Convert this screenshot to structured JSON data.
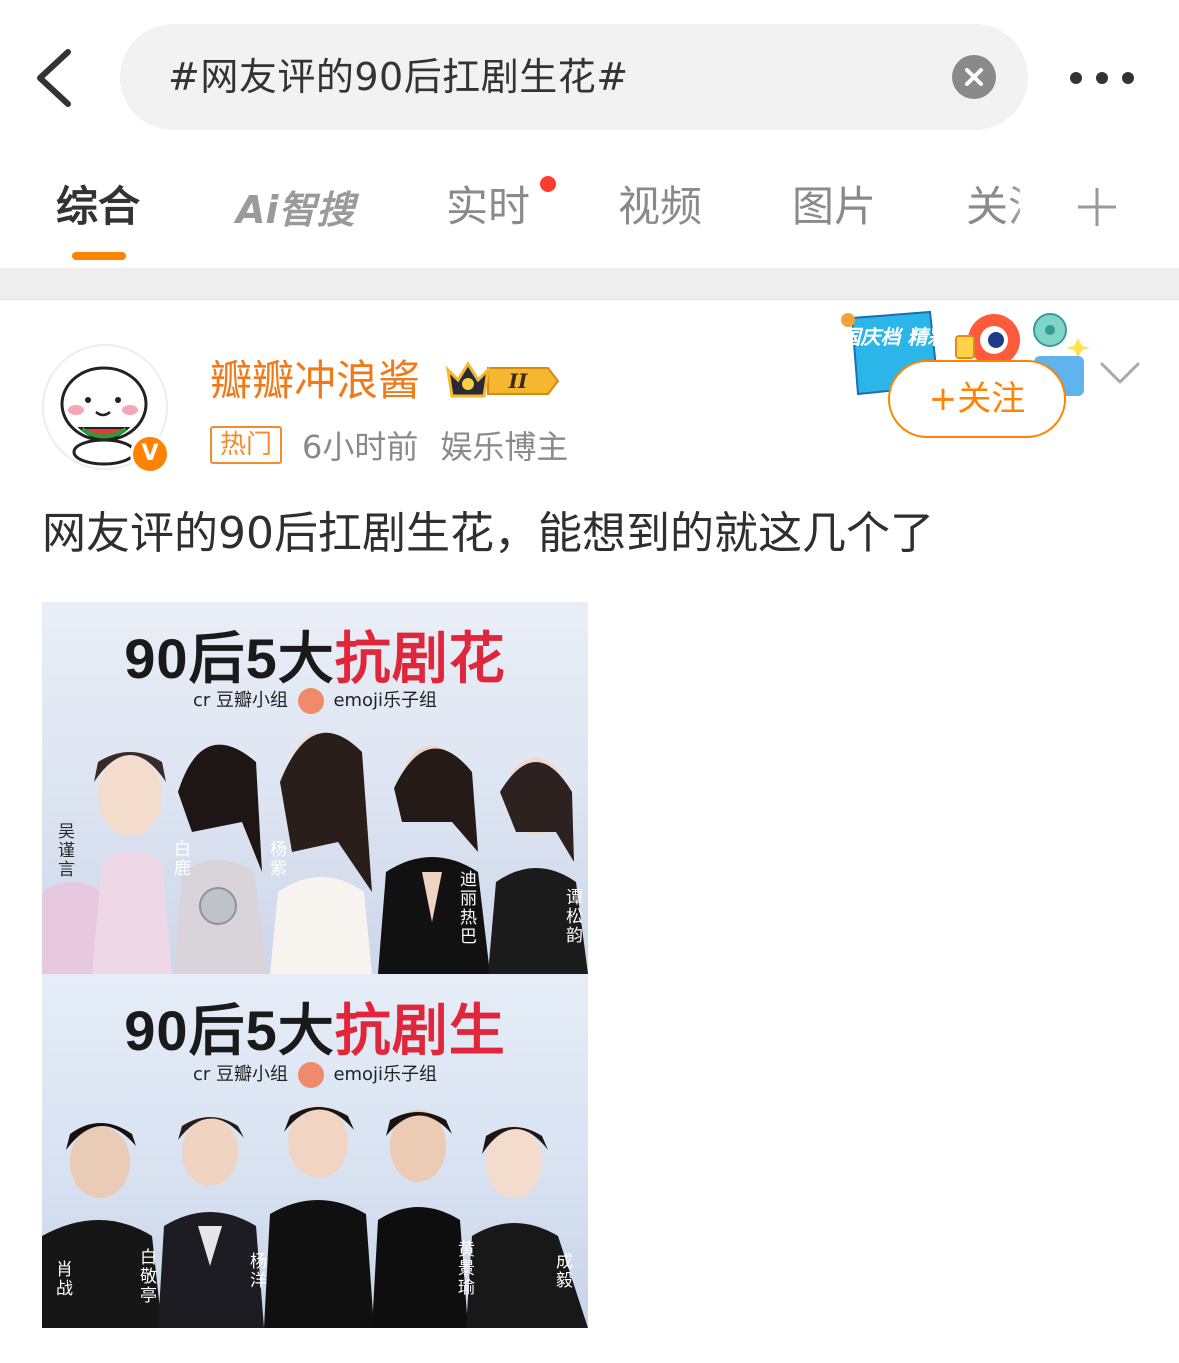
{
  "search": {
    "query": "#网友评的90后扛剧生花#"
  },
  "tabs": [
    {
      "label": "综合"
    },
    {
      "label": "Ai智搜"
    },
    {
      "label": "实时"
    },
    {
      "label": "视频"
    },
    {
      "label": "图片"
    },
    {
      "label": "关注"
    }
  ],
  "post": {
    "author": "瓣瓣冲浪酱",
    "member_level": "II",
    "tag": "热门",
    "time": "6小时前",
    "role": "娱乐博主",
    "follow_label": "+关注",
    "promo_text": "国庆档 精彩",
    "text": "网友评的90后扛剧生花，能想到的就这几个了",
    "image": {
      "panel1": {
        "title_prefix": "90后5大",
        "title_highlight": "抗剧花",
        "credit_left": "cr 豆瓣小组",
        "credit_right": "emoji乐子组",
        "names": [
          "吴谨言",
          "白鹿",
          "杨紫",
          "迪丽热巴",
          "谭松韵"
        ]
      },
      "panel2": {
        "title_prefix": "90后5大",
        "title_highlight": "抗剧生",
        "credit_left": "cr 豆瓣小组",
        "credit_right": "emoji乐子组",
        "names": [
          "肖战",
          "白敬亭",
          "杨洋",
          "黄景瑜",
          "成毅"
        ]
      }
    }
  },
  "colors": {
    "accent": "#ff8200",
    "username": "#f07a1a",
    "highlight_red": "#e0263a",
    "notification_dot": "#ff3b30"
  }
}
